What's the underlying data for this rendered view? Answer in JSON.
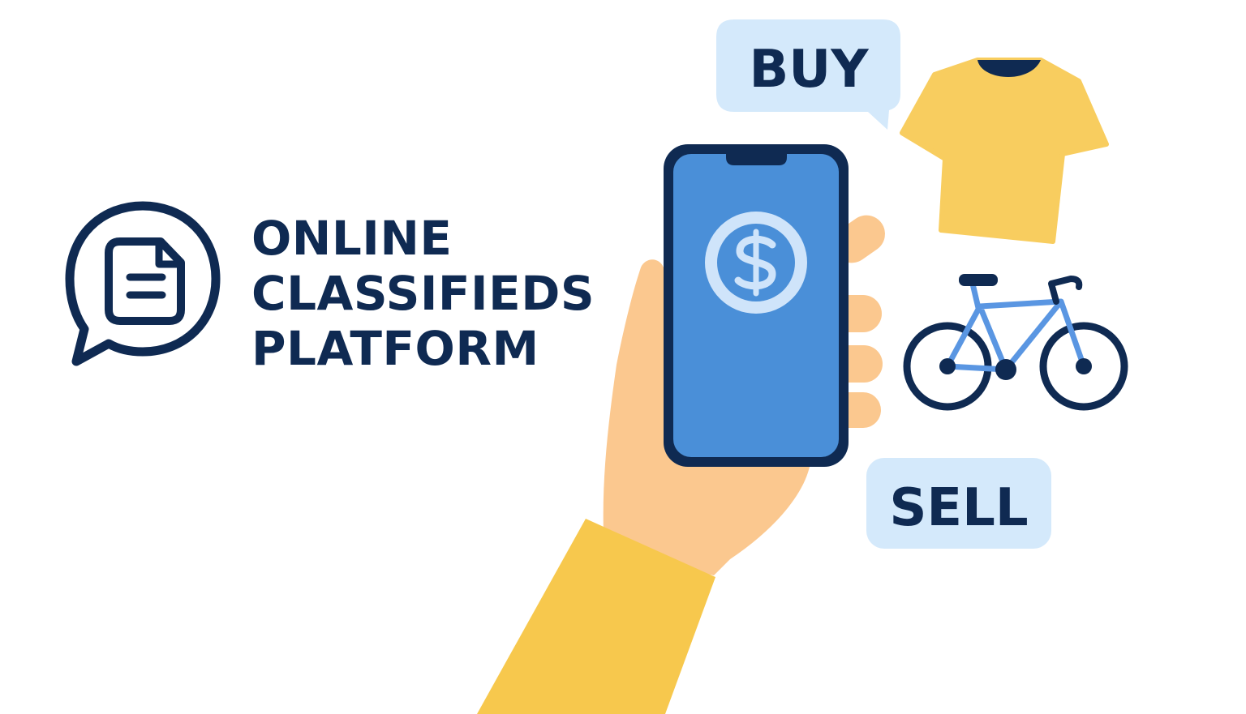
{
  "brand": {
    "title_lines": [
      "ONLINE",
      "CLASSIFIEDS",
      "PLATFORM"
    ],
    "logo_icon": "document-chat-icon"
  },
  "labels": {
    "buy": "BUY",
    "sell": "SELL"
  },
  "icons": {
    "phone_screen": "dollar-coin-icon",
    "item_1": "t-shirt-icon",
    "item_2": "bicycle-icon"
  },
  "colors": {
    "navy": "#0f2a52",
    "phone_screen": "#4a8fd8",
    "bubble_fill": "#d4e9fb",
    "shirt": "#f8cd5f",
    "sleeve": "#f7c84d",
    "skin": "#fbc88f",
    "bike_frame": "#5a96e2"
  }
}
